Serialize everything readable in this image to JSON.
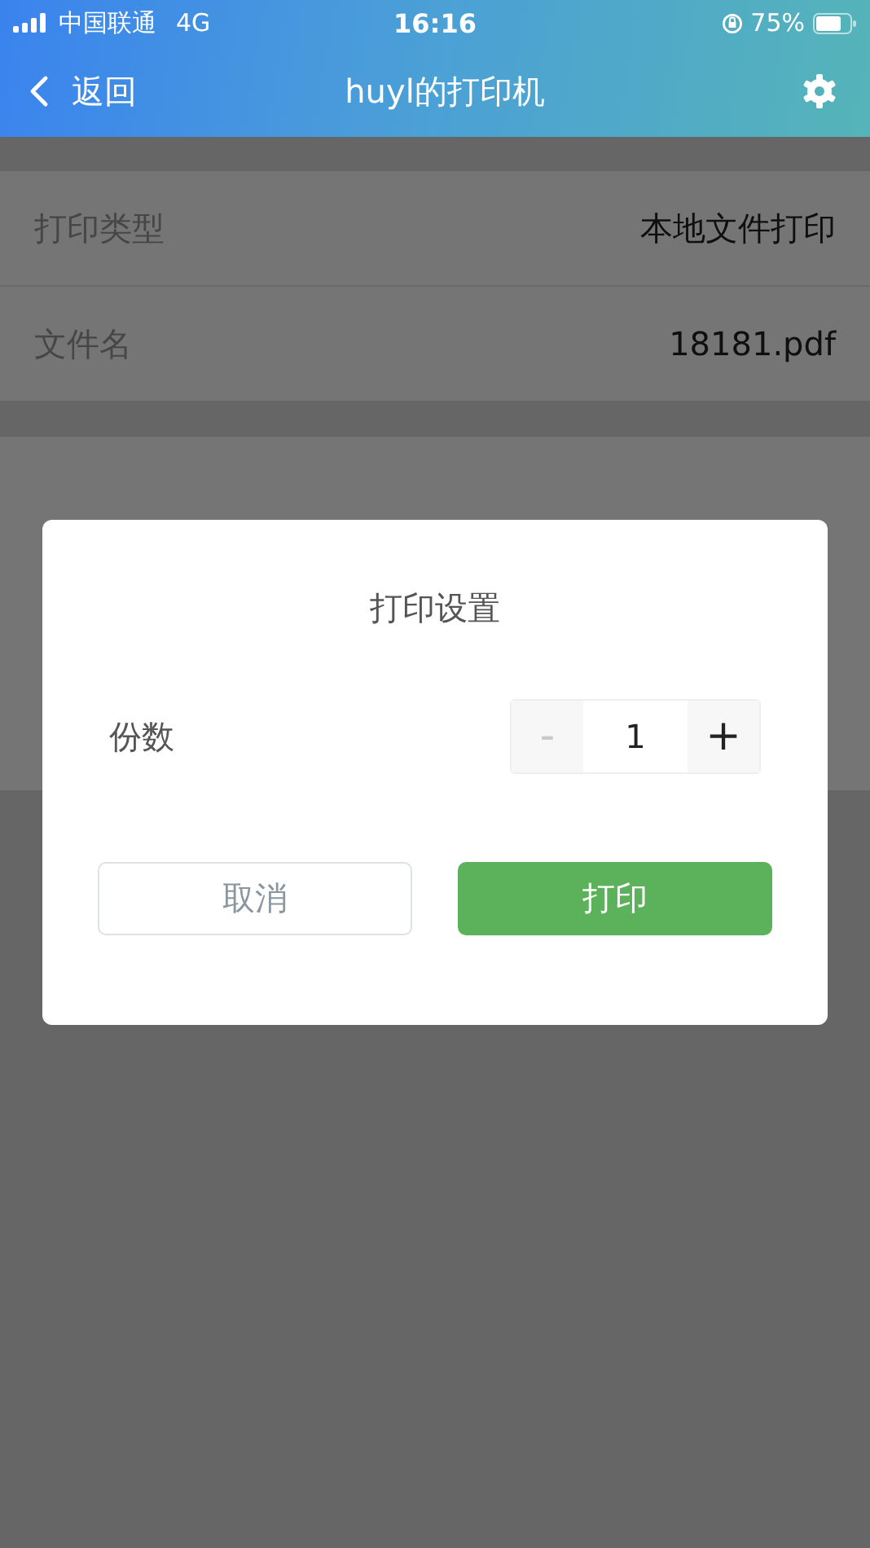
{
  "status_bar": {
    "carrier": "中国联通",
    "network": "4G",
    "time": "16:16",
    "battery": "75%"
  },
  "nav_bar": {
    "back": "返回",
    "title": "huyl的打印机"
  },
  "details": [
    {
      "label": "打印类型",
      "value": "本地文件打印"
    },
    {
      "label": "文件名",
      "value": "18181.pdf"
    }
  ],
  "dialog": {
    "title": "打印设置",
    "copies_label": "份数",
    "decrement": {
      "text": "-",
      "disabled": true
    },
    "copies": "1",
    "increment": {
      "text": "+",
      "disabled": false
    },
    "buttons": [
      {
        "kind": "secondary",
        "label": "取消"
      },
      {
        "kind": "primary",
        "label": "打印"
      }
    ]
  }
}
